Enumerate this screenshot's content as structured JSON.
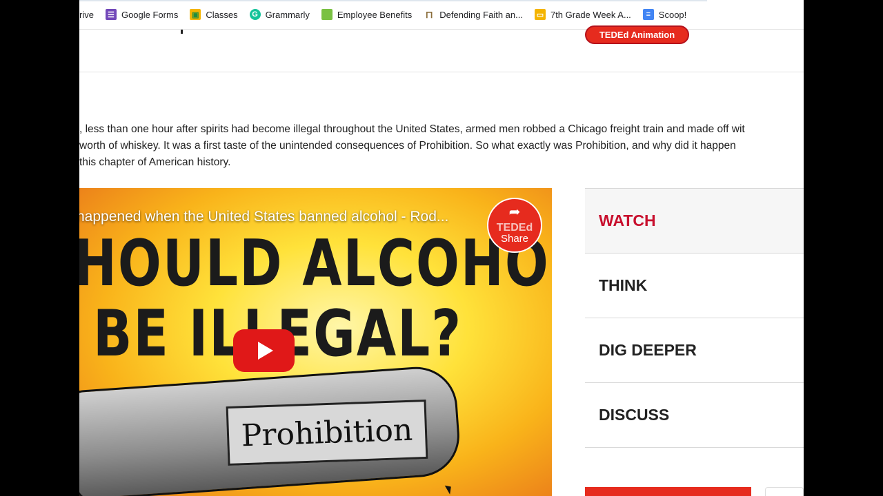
{
  "bookmarks": [
    {
      "label": "rive",
      "icon": "drive-icon",
      "color": "#1e8e3e"
    },
    {
      "label": "Google Forms",
      "icon": "forms-icon",
      "color": "#7248b9"
    },
    {
      "label": "Classes",
      "icon": "classroom-icon",
      "color": "#f4b400"
    },
    {
      "label": "Grammarly",
      "icon": "grammarly-icon",
      "color": "#15c39a"
    },
    {
      "label": "Employee Benefits",
      "icon": "benefits-icon",
      "color": "#7ac143"
    },
    {
      "label": "Defending Faith an...",
      "icon": "pillar-icon",
      "color": "#8a6d3b"
    },
    {
      "label": "7th Grade Week A...",
      "icon": "slides-icon",
      "color": "#f4b400"
    },
    {
      "label": "Scoop!",
      "icon": "docs-icon",
      "color": "#4285f4"
    }
  ],
  "header": {
    "badge": "TEDEd Animation"
  },
  "intro": {
    "line1": ", less than one hour after spirits had become illegal throughout the United States, armed men robbed a Chicago freight train and made off wit",
    "line2": "worth of whiskey. It was a first taste of the unintended consequences of Prohibition. So what exactly was Prohibition, and why did it happen",
    "line3": "this chapter of American history."
  },
  "video": {
    "title": "happened when the United States banned alcohol - Rod...",
    "headline1": "HOULD ALCOHOL",
    "headline2": "BE ILLEGAL?",
    "bottle_label": "Prohibition",
    "share_brand": "TEDEd",
    "share_label": "Share"
  },
  "tabs": [
    {
      "label": "WATCH",
      "active": true
    },
    {
      "label": "THINK",
      "active": false
    },
    {
      "label": "DIG DEEPER",
      "active": false
    },
    {
      "label": "DISCUSS",
      "active": false
    }
  ],
  "colors": {
    "accent": "#e62b1e",
    "active_tab": "#c8102e"
  }
}
